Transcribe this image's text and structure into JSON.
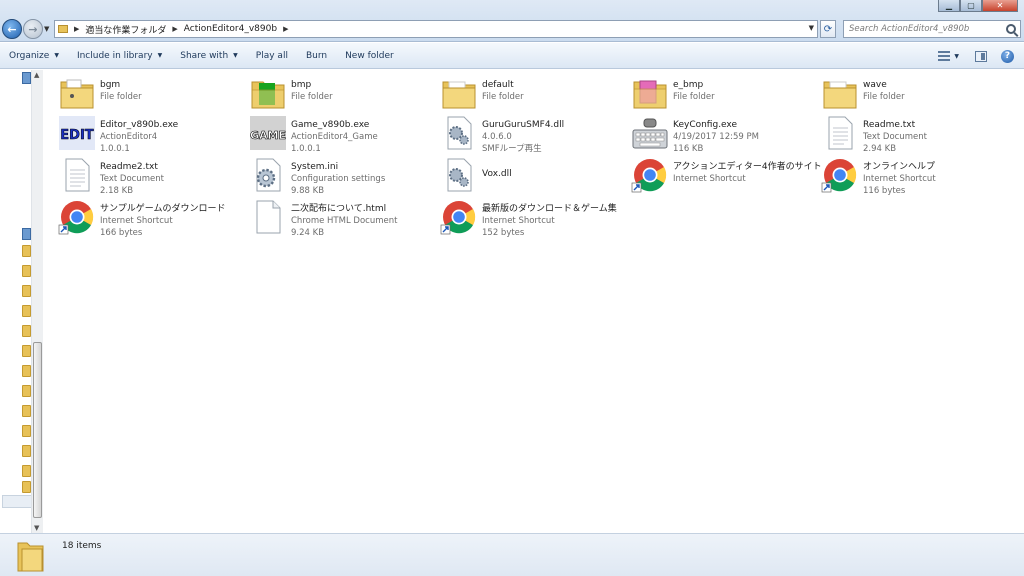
{
  "window": {
    "controls": {
      "minimize": "▁",
      "maximize": "▢",
      "close": "✕"
    }
  },
  "address": {
    "breadcrumbs": [
      "適当な作業フォルダ",
      "ActionEditor4_v890b"
    ]
  },
  "search": {
    "placeholder": "Search ActionEditor4_v890b"
  },
  "toolbar": {
    "organize": "Organize",
    "include_in_library": "Include in library",
    "share_with": "Share with",
    "play_all": "Play all",
    "burn": "Burn",
    "new_folder": "New folder"
  },
  "files": [
    {
      "name": "bgm",
      "line2": "File folder",
      "line3": "",
      "icon": "folder-music-icon"
    },
    {
      "name": "bmp",
      "line2": "File folder",
      "line3": "",
      "icon": "folder-green-icon"
    },
    {
      "name": "default",
      "line2": "File folder",
      "line3": "",
      "icon": "folder-icon"
    },
    {
      "name": "e_bmp",
      "line2": "File folder",
      "line3": "",
      "icon": "folder-pink-icon"
    },
    {
      "name": "wave",
      "line2": "File folder",
      "line3": "",
      "icon": "folder-icon"
    },
    {
      "name": "Editor_v890b.exe",
      "line2": "ActionEditor4",
      "line3": "1.0.0.1",
      "icon": "edit-exe-icon"
    },
    {
      "name": "Game_v890b.exe",
      "line2": "ActionEditor4_Game",
      "line3": "1.0.0.1",
      "icon": "game-exe-icon"
    },
    {
      "name": "GuruGuruSMF4.dll",
      "line2": "4.0.6.0",
      "line3": "SMFループ再生",
      "icon": "dll-gear-icon"
    },
    {
      "name": "KeyConfig.exe",
      "line2": "4/19/2017 12:59 PM",
      "line3": "116 KB",
      "icon": "keyboard-icon"
    },
    {
      "name": "Readme.txt",
      "line2": "Text Document",
      "line3": "2.94 KB",
      "icon": "text-document-icon"
    },
    {
      "name": "Readme2.txt",
      "line2": "Text Document",
      "line3": "2.18 KB",
      "icon": "text-document-icon"
    },
    {
      "name": "System.ini",
      "line2": "Configuration settings",
      "line3": "9.88 KB",
      "icon": "settings-file-icon"
    },
    {
      "name": "Vox.dll",
      "line2": "",
      "line3": "",
      "icon": "dll-gear-icon"
    },
    {
      "name": "アクションエディター4作者のサイト",
      "line2": "Internet Shortcut",
      "line3": "",
      "icon": "chrome-shortcut-icon"
    },
    {
      "name": "オンラインヘルプ",
      "line2": "Internet Shortcut",
      "line3": "116 bytes",
      "icon": "chrome-shortcut-icon"
    },
    {
      "name": "サンプルゲームのダウンロード",
      "line2": "Internet Shortcut",
      "line3": "166 bytes",
      "icon": "chrome-shortcut-icon"
    },
    {
      "name": "二次配布について.html",
      "line2": "Chrome HTML Document",
      "line3": "9.24 KB",
      "icon": "html-document-icon"
    },
    {
      "name": "最新版のダウンロード＆ゲーム集",
      "line2": "Internet Shortcut",
      "line3": "152 bytes",
      "icon": "chrome-shortcut-icon"
    }
  ],
  "status": {
    "item_count": "18 items"
  },
  "colors": {
    "folder": "#e8c35a",
    "toolbar_text": "#1e395b",
    "meta_text": "#6d6d6d"
  }
}
